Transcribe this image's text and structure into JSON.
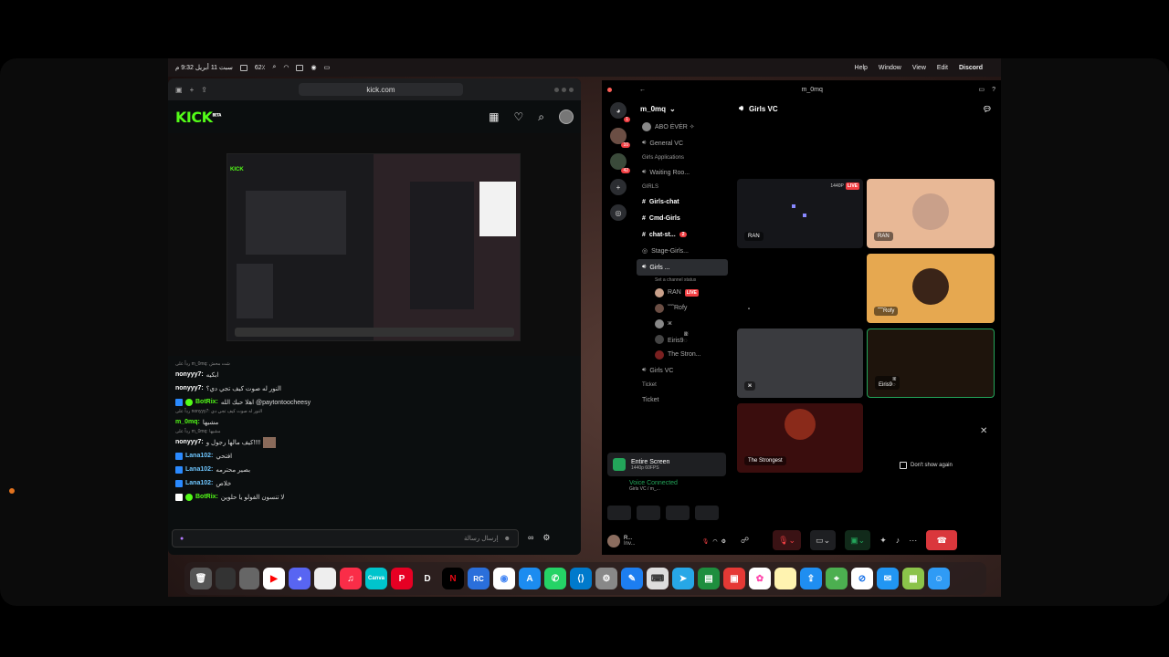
{
  "menubar": {
    "datetime": "سبت 11 أبريل 9:32 م",
    "battery": "62٪",
    "menu_help": "Help",
    "menu_window": "Window",
    "menu_view": "View",
    "menu_edit": "Edit",
    "menu_app": "Discord"
  },
  "kick": {
    "url": "kick.com",
    "logo": "KICK",
    "beta": "BETA",
    "chat_input_placeholder": "إرسال رسالة",
    "messages": [
      {
        "reply": "رداً على m_0mq: شت محش",
        "user": "nonyyy7:",
        "text": "ابكيه",
        "type": "normal"
      },
      {
        "reply": "",
        "user": "nonyyy7:",
        "text": "النور له صوت كيف تجي دي؟",
        "type": "normal"
      },
      {
        "reply": "",
        "user": "BotRix:",
        "text": "اهلا حبك الله @paytontoocheesy",
        "type": "bot"
      },
      {
        "reply": "رداً على nonyyy7: النور له صوت كيف تجي دي",
        "user": "m_0mq:",
        "text": "مشيها",
        "type": "green"
      },
      {
        "reply": "رداً على m_0mq: مشيها",
        "user": "nonyyy7:",
        "text": "كيف مالها رجول و!!!!",
        "type": "normal"
      },
      {
        "reply": "",
        "user": "Lana102:",
        "text": "افتحي",
        "type": "blue"
      },
      {
        "reply": "",
        "user": "Lana102:",
        "text": "بصير محترمه",
        "type": "blue"
      },
      {
        "reply": "",
        "user": "Lana102:",
        "text": "خلاص",
        "type": "blue"
      },
      {
        "reply": "",
        "user": "BotRix:",
        "text": "لا تنسون الفولو يا حلوين",
        "type": "bot"
      }
    ]
  },
  "discord": {
    "window_title": "m_0mq",
    "guild_name": "m_0mq",
    "server_badges": [
      "1",
      "10",
      "42"
    ],
    "channels": {
      "abo_ever": "ABO ĖVĖR ✧",
      "general_vc": "General VC",
      "cat_applications": "Girls Applications",
      "waiting_room": "Waiting Roo...",
      "cat_girls": "GIRLS",
      "girls_chat": "Girls-chat",
      "cmd_girls": "Cmd-Girls",
      "chat_st": "chat-st...",
      "chat_st_count": "2",
      "stage_girls": "Stage-Girls...",
      "girls_vc_active": "Girls ...",
      "set_status": "Set a channel status",
      "girls_vc": "Girls VC",
      "cat_ticket": "Ticket",
      "ticket": "Ticket"
    },
    "voice_members": [
      {
        "name": "RAN",
        "live": "LIVE"
      },
      {
        "name": "˜˜˜Rofy"
      },
      {
        "name": "ж"
      },
      {
        "name": "Eiris9ᢆ"
      },
      {
        "name": "The Stron..."
      }
    ],
    "screenshare": {
      "title": "Entire Screen",
      "sub": "1440p 60FPS"
    },
    "voice_connected": {
      "title": "Voice Connected",
      "sub": "Girls VC / m_..."
    },
    "user_panel": {
      "name": "R...",
      "status": "Inv..."
    },
    "vc_title": "Girls VC",
    "tiles": [
      {
        "label": "RAN",
        "quality": "1440P",
        "live": "LIVE"
      },
      {
        "label": "RAN"
      },
      {
        "label": "\""
      },
      {
        "label": "˜˜˜Rofy"
      },
      {
        "label": "ж"
      },
      {
        "label": "Eiris9ᢆ"
      },
      {
        "label": "The Strongest"
      }
    ],
    "dont_show_again": "Don't show again"
  },
  "dock": {
    "apps": [
      "trash-icon",
      "finder-window",
      "youtube-icon",
      "discord-icon",
      "app-icon",
      "music-icon",
      "canva-icon",
      "pinterest-icon",
      "D",
      "netflix-icon",
      "app-icon",
      "chrome-icon",
      "appstore-icon",
      "whatsapp-icon",
      "vscode-icon",
      "settings-icon",
      "app-icon",
      "keyboard-icon",
      "telegram-icon",
      "app-icon",
      "app-icon",
      "photos-icon",
      "notes-icon",
      "app-icon",
      "maps-icon",
      "safari-icon",
      "mail-icon",
      "app-icon",
      "finder-icon"
    ],
    "d_label": "D",
    "canva_label": "Canva",
    "rc_label": "RC"
  },
  "colors": {
    "kick_green": "#53fc18",
    "discord_live": "#f23f43",
    "discord_green": "#23a55a"
  }
}
